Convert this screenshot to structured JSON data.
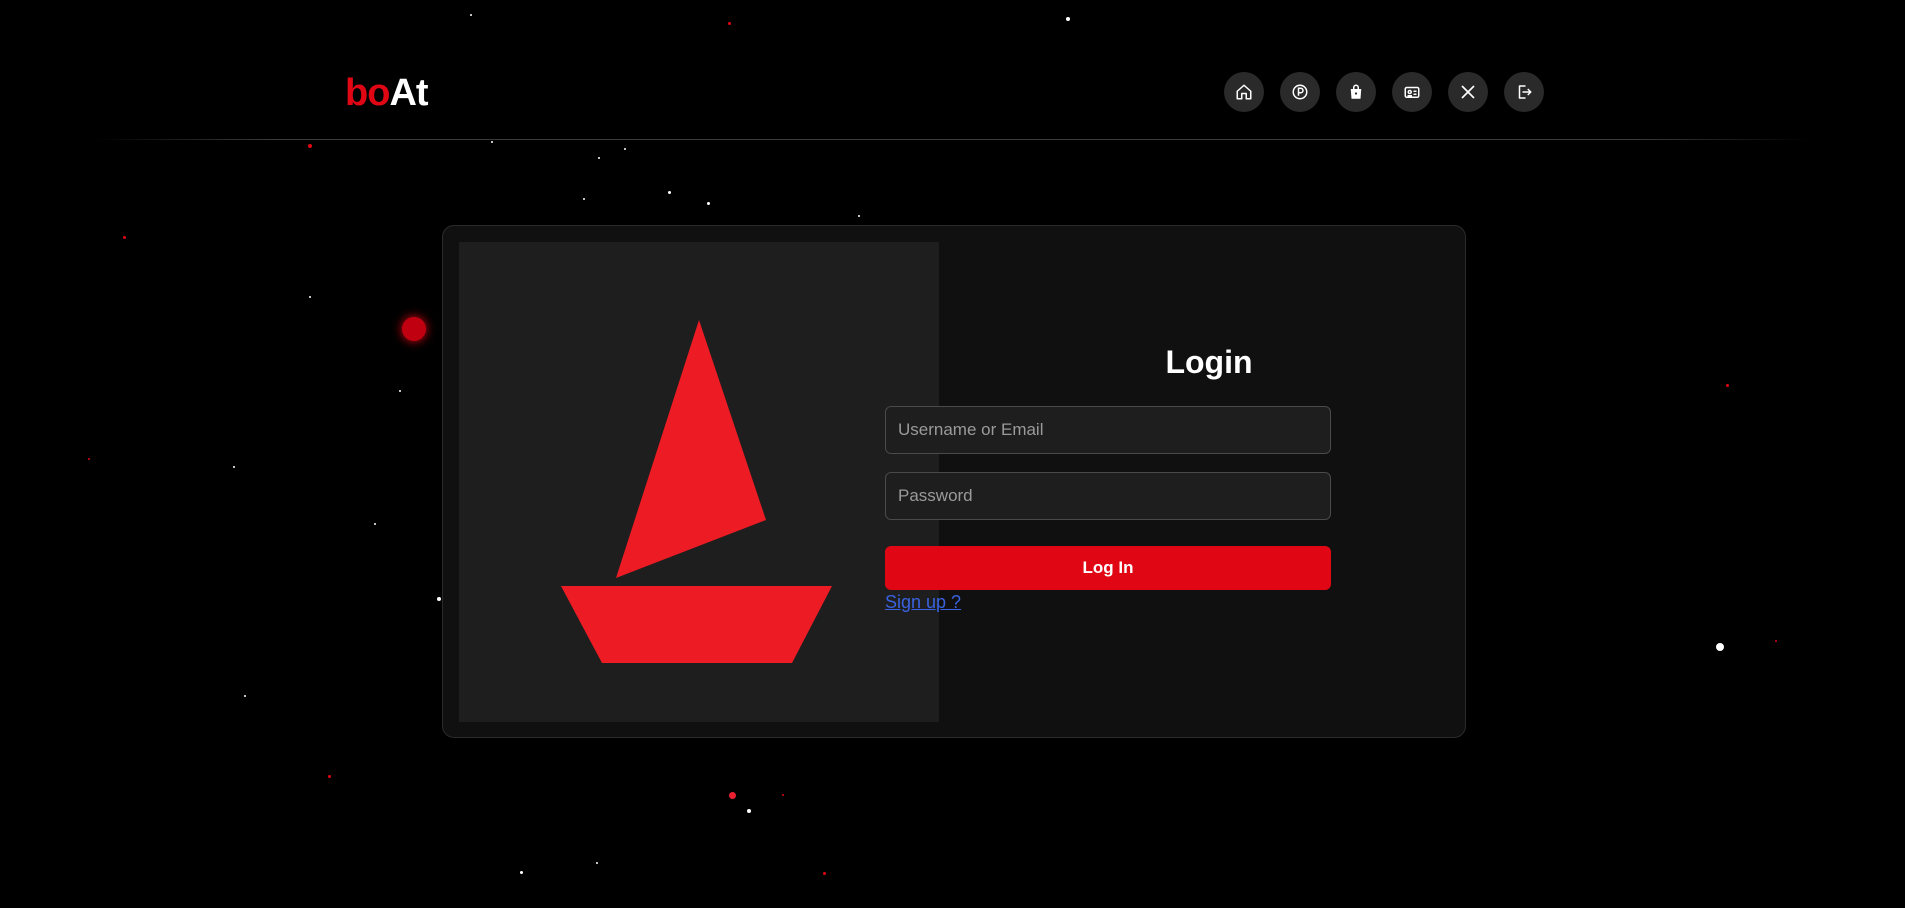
{
  "header": {
    "brand_part1": "bo",
    "brand_part2": "At",
    "nav": [
      {
        "icon": "home-icon",
        "label": "Home"
      },
      {
        "icon": "parking-icon",
        "label": "Parking"
      },
      {
        "icon": "shopping-bag-icon",
        "label": "Shop"
      },
      {
        "icon": "id-card-icon",
        "label": "Profile"
      },
      {
        "icon": "x-logo-icon",
        "label": "X"
      },
      {
        "icon": "logout-icon",
        "label": "Logout"
      }
    ]
  },
  "login": {
    "title": "Login",
    "username_placeholder": "Username or Email",
    "password_placeholder": "Password",
    "submit_label": "Log In",
    "signup_link": "Sign up ?"
  },
  "colors": {
    "accent": "#e10614",
    "boat": "#ed1c24",
    "background": "#000000",
    "link": "#3a62e0"
  }
}
